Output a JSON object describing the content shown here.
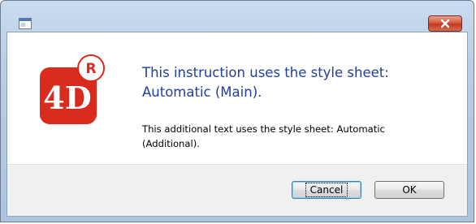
{
  "window": {
    "title": "",
    "app_icon": "window-app-icon",
    "close_icon": "close-icon"
  },
  "logo": {
    "icon": "4d-logo-icon",
    "text": "4D",
    "badge": "R",
    "colors": {
      "primary": "#d92b1e",
      "badge_bg": "#ffffff",
      "text": "#ffffff"
    }
  },
  "message": {
    "main": "This instruction uses the style sheet: Automatic (Main).",
    "additional": "This additional text uses the style sheet: Automatic (Additional)."
  },
  "buttons": {
    "cancel": "Cancel",
    "ok": "OK"
  },
  "colors": {
    "main_text": "#1e3f9e",
    "close_button": "#c0391f",
    "button_bar": "#f0f0f0"
  }
}
